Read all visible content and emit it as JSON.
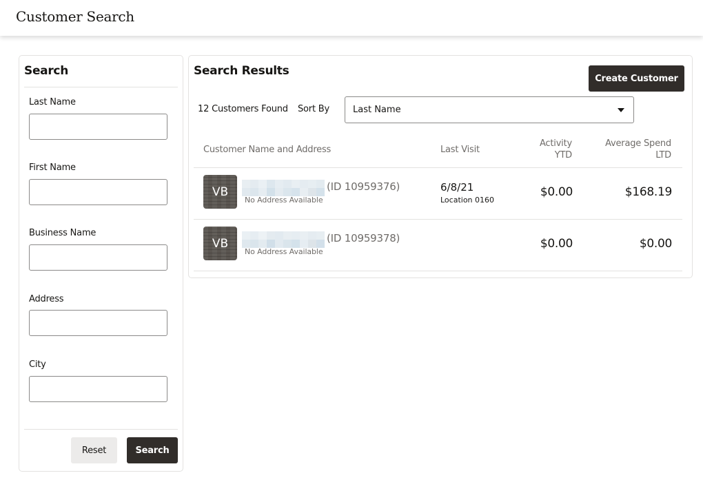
{
  "header": {
    "title": "Customer Search"
  },
  "search_panel": {
    "heading": "Search",
    "fields": [
      {
        "label": "Last Name",
        "value": "",
        "placeholder": ""
      },
      {
        "label": "First Name",
        "value": "",
        "placeholder": ""
      },
      {
        "label": "Business Name",
        "value": "",
        "placeholder": ""
      },
      {
        "label": "Address",
        "value": "",
        "placeholder": ""
      },
      {
        "label": "City",
        "value": "",
        "placeholder": ""
      }
    ],
    "reset_label": "Reset",
    "search_label": "Search"
  },
  "results_panel": {
    "heading": "Search Results",
    "create_label": "Create Customer",
    "count_text": "12 Customers Found",
    "sort_by_label": "Sort By",
    "sort_selected": "Last Name",
    "columns": {
      "name_address": "Customer Name and Address",
      "last_visit": "Last Visit",
      "activity_line1": "Activity",
      "activity_line2": "YTD",
      "avg_spend_line1": "Average Spend",
      "avg_spend_line2": "LTD"
    },
    "rows": [
      {
        "initials": "VB",
        "name": "[redacted]",
        "id_text": "(ID 10959376)",
        "address": "No Address Available",
        "last_visit_date": "6/8/21",
        "last_visit_location": "Location 0160",
        "activity_ytd": "$0.00",
        "avg_spend_ltd": "$168.19"
      },
      {
        "initials": "VB",
        "name": "[redacted]",
        "id_text": "(ID 10959378)",
        "address": "No Address Available",
        "last_visit_date": "",
        "last_visit_location": "",
        "activity_ytd": "$0.00",
        "avg_spend_ltd": "$0.00"
      }
    ]
  },
  "colors": {
    "primary_button": "#312d2a",
    "secondary_button": "#ecebea",
    "border": "#e3e2e0",
    "muted_text": "#6f6c69",
    "avatar": "#5a5550"
  }
}
